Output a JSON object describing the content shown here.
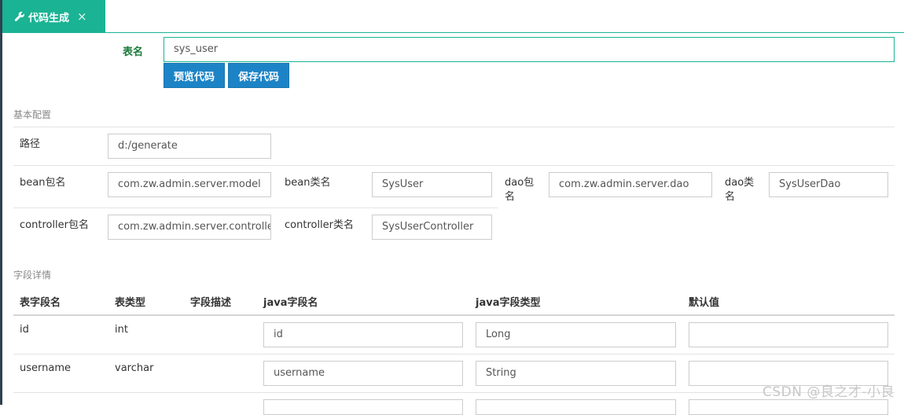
{
  "tab": {
    "label": "代码生成",
    "close": "×"
  },
  "table_name": {
    "label": "表名",
    "value": "sys_user"
  },
  "buttons": {
    "preview": "预览代码",
    "save": "保存代码"
  },
  "basic_config": {
    "title": "基本配置",
    "path_label": "路径",
    "path_value": "d:/generate",
    "bean_pkg_label": "bean包名",
    "bean_pkg_value": "com.zw.admin.server.model",
    "bean_class_label": "bean类名",
    "bean_class_value": "SysUser",
    "dao_pkg_label_1": "dao包",
    "dao_pkg_label_2": "名",
    "dao_pkg_value": "com.zw.admin.server.dao",
    "dao_class_label_1": "dao类",
    "dao_class_label_2": "名",
    "dao_class_value": "SysUserDao",
    "controller_pkg_label": "controller包名",
    "controller_pkg_value": "com.zw.admin.server.controller",
    "controller_class_label": "controller类名",
    "controller_class_value": "SysUserController"
  },
  "fields": {
    "title": "字段详情",
    "headers": [
      "表字段名",
      "表类型",
      "字段描述",
      "java字段名",
      "java字段类型",
      "默认值"
    ],
    "rows": [
      {
        "column": "id",
        "type": "int",
        "desc": "",
        "java_name": "id",
        "java_type": "Long",
        "default": ""
      },
      {
        "column": "username",
        "type": "varchar",
        "desc": "",
        "java_name": "username",
        "java_type": "String",
        "default": ""
      }
    ]
  },
  "watermark": "CSDN @良之才-小良"
}
